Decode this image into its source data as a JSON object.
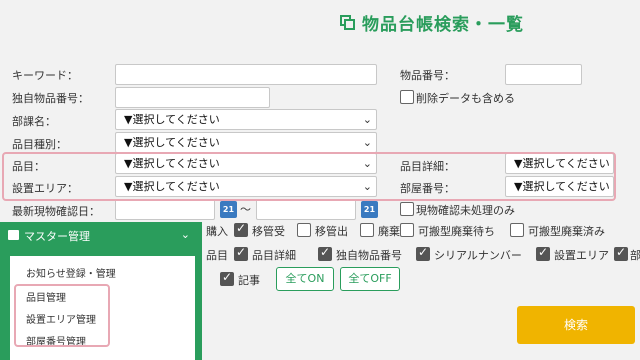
{
  "title": "物品台帳検索・一覧",
  "form": {
    "keyword_label": "キーワード：",
    "item_number_label": "物品番号：",
    "unique_item_number_label": "独自物品番号：",
    "include_deleted_label": "削除データも含める",
    "department_label": "部課名：",
    "category_type_label": "品目種別：",
    "item_label": "品目：",
    "item_detail_label": "品目詳細：",
    "location_area_label": "設置エリア：",
    "room_number_label": "部屋番号：",
    "last_confirmed_label": "最新現物確認日：",
    "range_sep": "〜",
    "unprocessed_only_label": "現物確認未処理のみ",
    "placeholder_select": "▼選択してください",
    "calendar_text": "21"
  },
  "status_checks": [
    {
      "label": "購入",
      "checked": false
    },
    {
      "label": "移管受",
      "checked": true
    },
    {
      "label": "移管出",
      "checked": false
    },
    {
      "label": "廃棄",
      "checked": false
    },
    {
      "label": "可搬型廃棄待ち",
      "checked": false
    },
    {
      "label": "可搬型廃棄済み",
      "checked": false
    }
  ],
  "column_checks": [
    {
      "label": "品目",
      "checked": true
    },
    {
      "label": "品目詳細",
      "checked": true
    },
    {
      "label": "独自物品番号",
      "checked": true
    },
    {
      "label": "シリアルナンバー",
      "checked": true
    },
    {
      "label": "設置エリア",
      "checked": true
    },
    {
      "label": "部",
      "checked": true
    }
  ],
  "extra_checks": [
    {
      "label": "記事",
      "checked": true
    }
  ],
  "buttons": {
    "all_on": "全てON",
    "all_off": "全てOFF",
    "search": "検索"
  },
  "master_panel": {
    "title": "マスター管理",
    "chevron": "⌄",
    "items": [
      "お知らせ登録・管理",
      "品目管理",
      "設置エリア管理",
      "部屋番号管理"
    ]
  },
  "colors": {
    "accent_green": "#2a9d5c",
    "search_orange": "#f0b400",
    "highlight_pink": "#e8a8b4"
  }
}
